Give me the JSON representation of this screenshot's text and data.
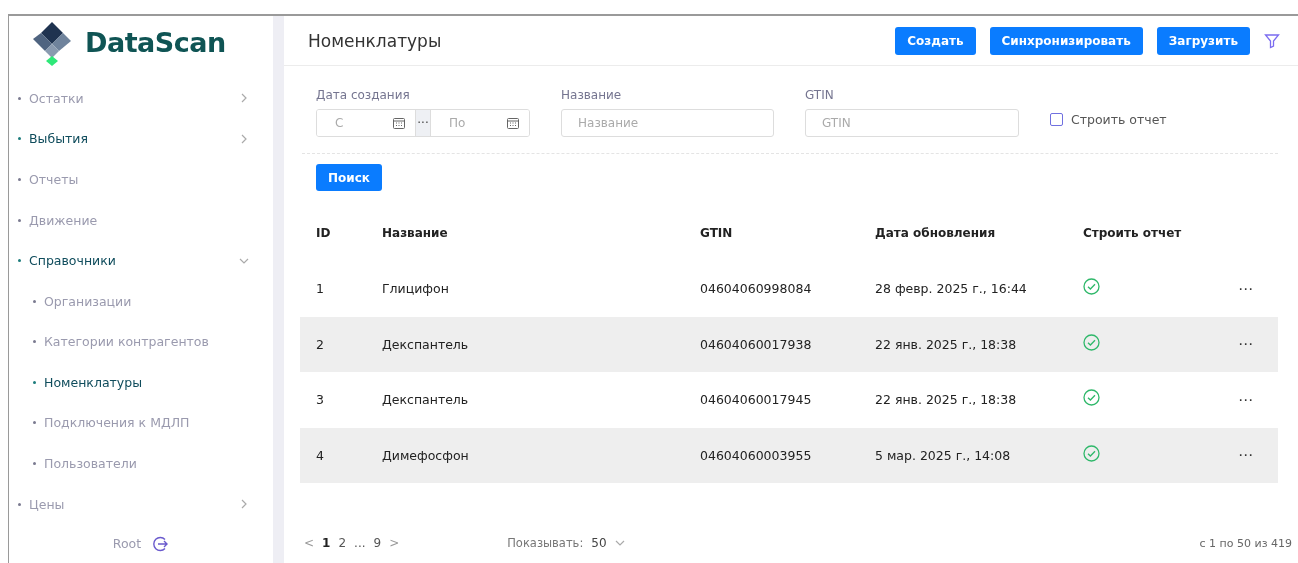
{
  "brand": {
    "name": "DataScan"
  },
  "sidebar": {
    "items": [
      {
        "label": "Остатки",
        "active": false,
        "expandable": true,
        "expanded": false
      },
      {
        "label": "Выбытия",
        "active": true,
        "expandable": true,
        "expanded": false
      },
      {
        "label": "Отчеты",
        "active": false,
        "expandable": false
      },
      {
        "label": "Движение",
        "active": false,
        "expandable": false
      },
      {
        "label": "Справочники",
        "active": true,
        "expandable": true,
        "expanded": true,
        "children": [
          {
            "label": "Организации",
            "selected": false
          },
          {
            "label": "Категории контрагентов",
            "selected": false
          },
          {
            "label": "Номенклатуры",
            "selected": true
          },
          {
            "label": "Подключения к МДЛП",
            "selected": false
          },
          {
            "label": "Пользователи",
            "selected": false
          }
        ]
      },
      {
        "label": "Цены",
        "active": false,
        "expandable": true,
        "expanded": false
      }
    ],
    "user": "Root"
  },
  "page": {
    "title": "Номенклатуры",
    "buttons": [
      "Создать",
      "Синхронизировать",
      "Загрузить"
    ]
  },
  "filters": {
    "date_label": "Дата создания",
    "date_from": {
      "placeholder": "С"
    },
    "date_to": {
      "placeholder": "По"
    },
    "date_separator": "···",
    "name_label": "Название",
    "name": {
      "placeholder": "Название"
    },
    "gtin_label": "GTIN",
    "gtin": {
      "placeholder": "GTIN"
    },
    "report_checkbox": {
      "label": "Строить отчет",
      "checked": false
    },
    "search_button": "Поиск"
  },
  "table": {
    "columns": [
      "ID",
      "Название",
      "GTIN",
      "Дата обновления",
      "Строить отчет"
    ],
    "rows": [
      {
        "id": "1",
        "name": "Глицифон",
        "gtin": "04604060998084",
        "updated": "28 февр. 2025 г., 16:44",
        "report": true,
        "shaded": false,
        "menu": "⋯"
      },
      {
        "id": "2",
        "name": "Декспантель",
        "gtin": "04604060017938",
        "updated": "22 янв. 2025 г., 18:38",
        "report": true,
        "shaded": true,
        "menu": "⋯"
      },
      {
        "id": "3",
        "name": "Декспантель",
        "gtin": "04604060017945",
        "updated": "22 янв. 2025 г., 18:38",
        "report": true,
        "shaded": false,
        "menu": "⋯"
      },
      {
        "id": "4",
        "name": "Димефосфон",
        "gtin": "04604060003955",
        "updated": "5 мар. 2025 г., 14:08",
        "report": true,
        "shaded": true,
        "menu": "⋯"
      }
    ]
  },
  "pagination": {
    "prev": "<",
    "pages": [
      {
        "label": "1",
        "selected": true
      },
      {
        "label": "2",
        "selected": false
      },
      {
        "label": "...",
        "selected": false
      },
      {
        "label": "9",
        "selected": false
      }
    ],
    "next": ">",
    "page_size_label": "Показывать:",
    "page_size": "50",
    "range": "с 1 по 50 из 419"
  }
}
